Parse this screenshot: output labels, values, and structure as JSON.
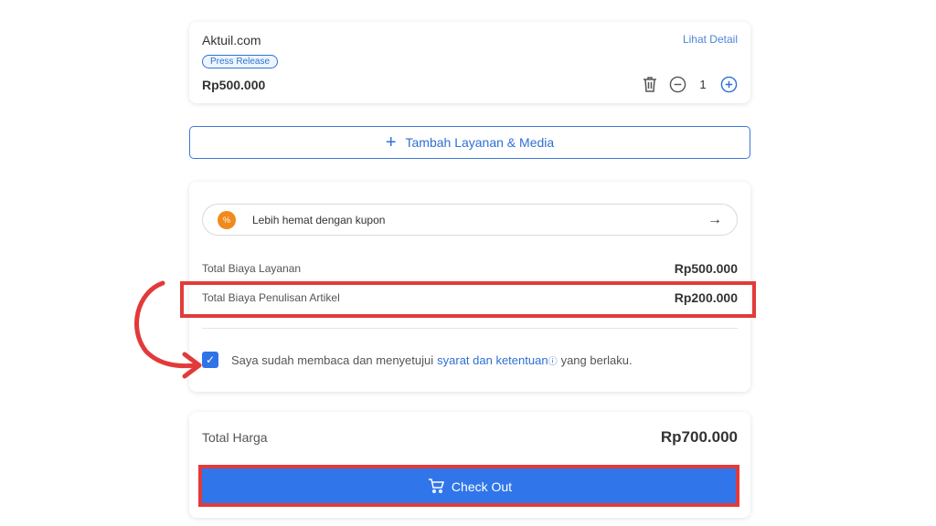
{
  "product": {
    "site_name": "Aktuil.com",
    "detail_link": "Lihat Detail",
    "badge": "Press Release",
    "price": "Rp500.000",
    "quantity": "1",
    "icons": {
      "delete": "trash-icon",
      "decrease": "minus-circle-icon",
      "increase": "plus-circle-icon"
    }
  },
  "add_service": {
    "icon": "+",
    "label": "Tambah Layanan & Media"
  },
  "coupon": {
    "icon": "%",
    "label": "Lebih hemat dengan kupon",
    "arrow": "→"
  },
  "summary": {
    "service_label": "Total Biaya Layanan",
    "service_value": "Rp500.000",
    "writing_label": "Total Biaya Penulisan Artikel",
    "writing_value": "Rp200.000"
  },
  "terms": {
    "checked": true,
    "check_mark": "✓",
    "prefix": "Saya sudah membaca dan menyetujui",
    "link": "syarat dan ketentuan",
    "info_icon": "ⓘ",
    "suffix": "yang berlaku."
  },
  "total": {
    "label": "Total Harga",
    "value": "Rp700.000"
  },
  "checkout": {
    "label": "Check Out",
    "icon": "cart-icon"
  },
  "colors": {
    "primary": "#3076ea",
    "highlight": "#e23a3a",
    "coupon": "#f08a1c"
  }
}
